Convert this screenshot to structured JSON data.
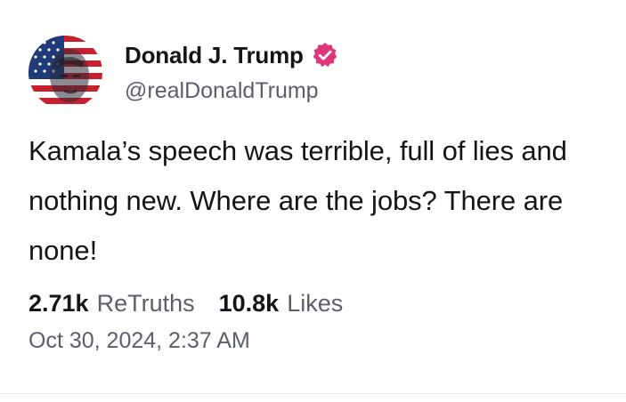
{
  "post": {
    "author": {
      "display_name": "Donald J. Trump",
      "handle": "@realDonaldTrump",
      "avatar_icon": "flag-portrait-avatar",
      "verified_icon": "verified-badge-icon",
      "verified_color": "#e0357a"
    },
    "text": "Kamala’s speech was terrible, full of lies and nothing new. Where are the jobs? There are none!",
    "stats": {
      "retruths_count": "2.71k",
      "retruths_label": "ReTruths",
      "likes_count": "10.8k",
      "likes_label": "Likes"
    },
    "timestamp": "Oct 30, 2024, 2:37 AM"
  },
  "colors": {
    "text_primary": "#141419",
    "text_secondary": "#5b5f6b",
    "divider": "#e6e6ea"
  }
}
